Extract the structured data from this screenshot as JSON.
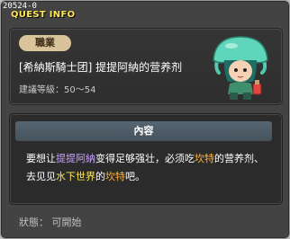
{
  "window": {
    "quest_id": "20524-0",
    "title": "QUEST INFO"
  },
  "quest": {
    "job_badge": "職業",
    "title": "[希納斯騎士团] 提提阿納的营养剂",
    "recommend_level": "建議等級：50～54"
  },
  "content": {
    "header": "內容",
    "segments": [
      {
        "text": "要想让",
        "style": "normal"
      },
      {
        "text": "提提阿納",
        "style": "purple"
      },
      {
        "text": "变得足够强壮，必须吃",
        "style": "normal"
      },
      {
        "text": "坎特",
        "style": "orange"
      },
      {
        "text": "的营养剂、去见见",
        "style": "normal"
      },
      {
        "text": "水下世界",
        "style": "green"
      },
      {
        "text": "的",
        "style": "normal"
      },
      {
        "text": "坎特",
        "style": "orange"
      },
      {
        "text": "吧。",
        "style": "normal"
      }
    ]
  },
  "status": {
    "text": "狀態： 可開始"
  },
  "colors": {
    "title_yellow": "#ffe85a",
    "npc_highlight": "#c8a2ff",
    "item_highlight": "#ffb23a",
    "location_highlight": "#ffe84a"
  },
  "icons": {
    "npc_portrait": "jellyfish-hat-npc-portrait"
  }
}
